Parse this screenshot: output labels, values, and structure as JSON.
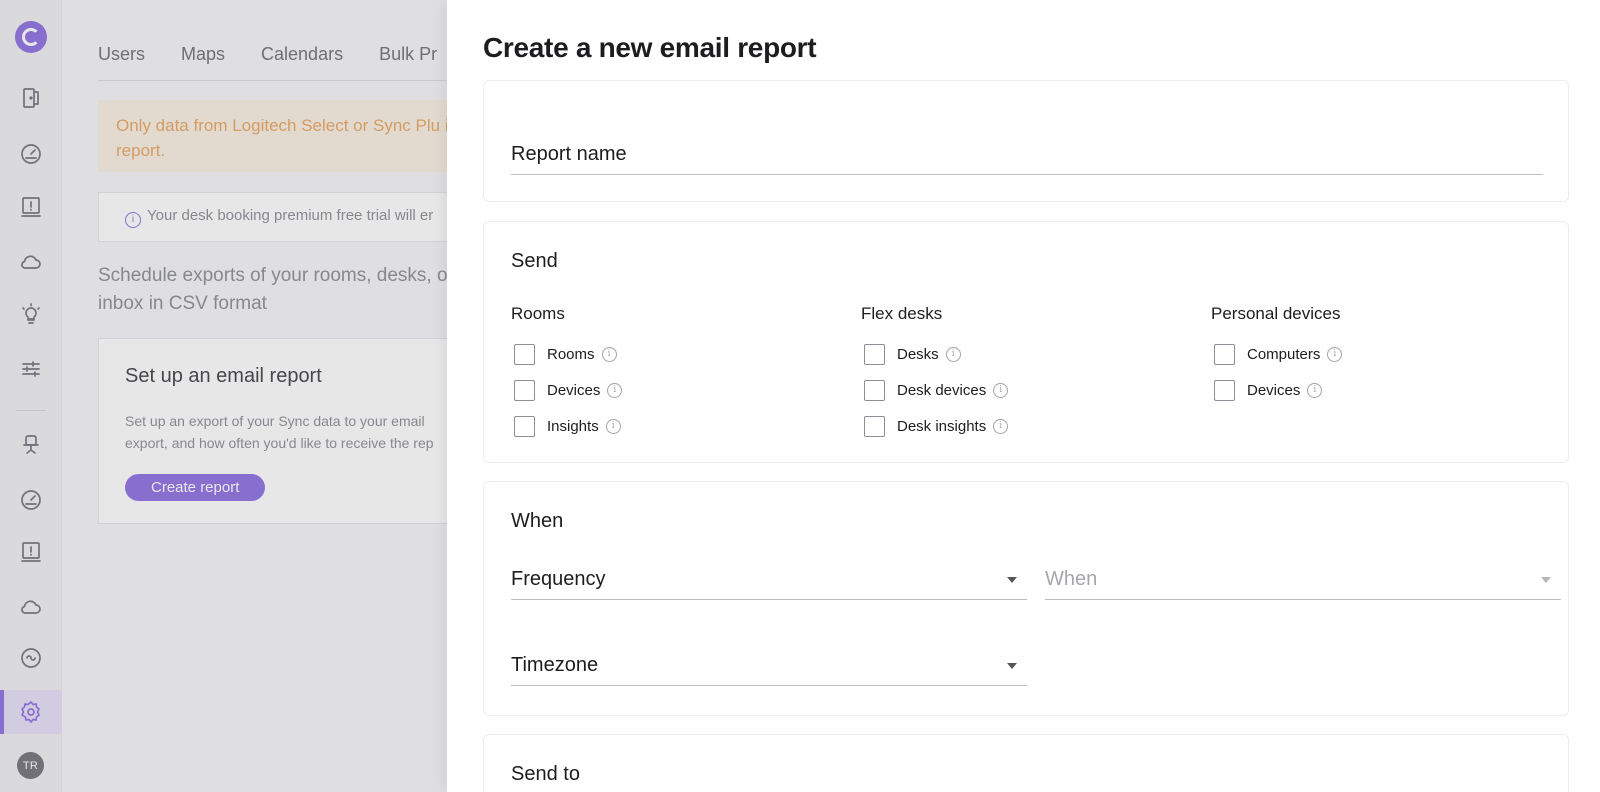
{
  "background": {
    "tabs": [
      "Users",
      "Maps",
      "Calendars",
      "Bulk Pr"
    ],
    "notice": "Only data from Logitech Select or Sync Plu in the report.",
    "trial_text": "Your desk booking premium free trial will er",
    "schedule_text": "Schedule exports of your rooms, desks, o inbox in CSV format",
    "setup_card": {
      "title": "Set up an email report",
      "description": "Set up an export of your Sync data to your email export, and how often you'd like to receive the rep",
      "button": "Create report"
    }
  },
  "sidebar": {
    "icons": [
      "logo-icon",
      "door-icon",
      "gauge-icon",
      "alert-board-icon",
      "cloud-icon",
      "lightbulb-icon",
      "sliders-icon",
      "desk-chair-icon",
      "gauge-icon",
      "alert-board-icon",
      "cloud-icon",
      "link-circle-icon",
      "gear-icon"
    ],
    "avatar": "TR"
  },
  "drawer": {
    "title": "Create a new email report",
    "report_name_label": "Report name",
    "send": {
      "title": "Send",
      "columns": [
        {
          "title": "Rooms",
          "options": [
            "Rooms",
            "Devices",
            "Insights"
          ]
        },
        {
          "title": "Flex desks",
          "options": [
            "Desks",
            "Desk devices",
            "Desk insights"
          ]
        },
        {
          "title": "Personal devices",
          "options": [
            "Computers",
            "Devices"
          ]
        }
      ]
    },
    "when": {
      "title": "When",
      "frequency_label": "Frequency",
      "when_label": "When",
      "timezone_label": "Timezone"
    },
    "send_to": {
      "title": "Send to"
    }
  },
  "colors": {
    "accent": "#8c6ce0",
    "notice_text": "#e8a45c"
  }
}
